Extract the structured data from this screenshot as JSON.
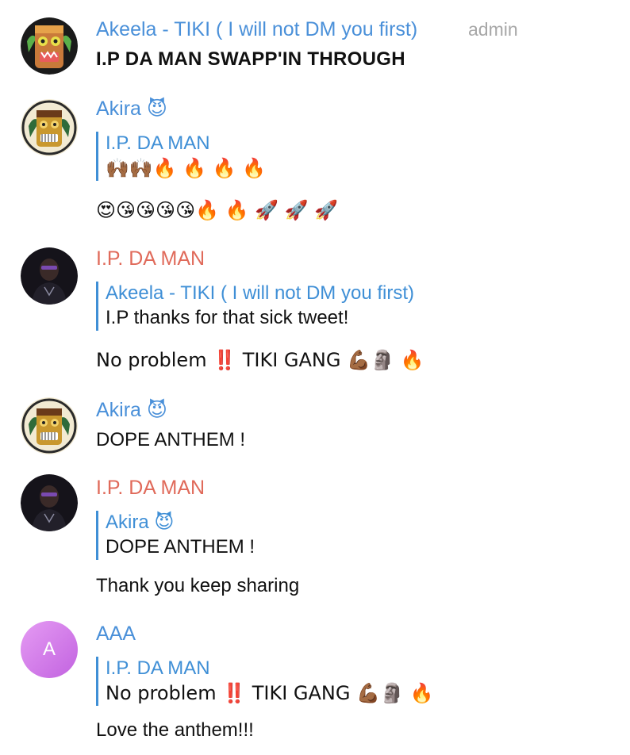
{
  "colors": {
    "blue_name": "#4a90d9",
    "red_name": "#e06a5a",
    "reply_bar": "#3f8fd6",
    "admin_gray": "#a7a7a7",
    "aaa_avatar": "#d07ee8"
  },
  "messages": [
    {
      "author": "Akeela - TIKI ( I will not DM you first)",
      "badge": "admin",
      "avatar_icon": "tiki-mask-green-avatar",
      "text": "I.P DA MAN SWAPP'IN THROUGH"
    },
    {
      "author": "Akira 😈",
      "avatar_icon": "tiki-mask-gold-avatar",
      "reply_author": "I.P. DA MAN",
      "reply_text": "🙌🏾🙌🏾🔥 🔥 🔥 🔥",
      "text": "😍😘😘😘😘🔥 🔥 🚀 🚀 🚀"
    },
    {
      "author": "I.P. DA MAN",
      "avatar_icon": "profile-photo-avatar",
      "reply_author": "Akeela - TIKI ( I will not DM you first)",
      "reply_text": "I.P thanks for that sick tweet!",
      "text": "No problem ‼️ TIKI GANG 💪🏾🗿 🔥"
    },
    {
      "author": "Akira 😈",
      "avatar_icon": "tiki-mask-gold-avatar",
      "text": "DOPE ANTHEM !"
    },
    {
      "author": "I.P. DA MAN",
      "avatar_icon": "profile-photo-avatar",
      "reply_author": "Akira 😈",
      "reply_text": "DOPE ANTHEM !",
      "text": "Thank you keep sharing"
    },
    {
      "author": "AAA",
      "avatar_letter": "A",
      "reply_author": "I.P. DA MAN",
      "reply_text": "No problem ‼️ TIKI GANG 💪🏾🗿 🔥",
      "text": "Love the anthem!!!"
    }
  ]
}
